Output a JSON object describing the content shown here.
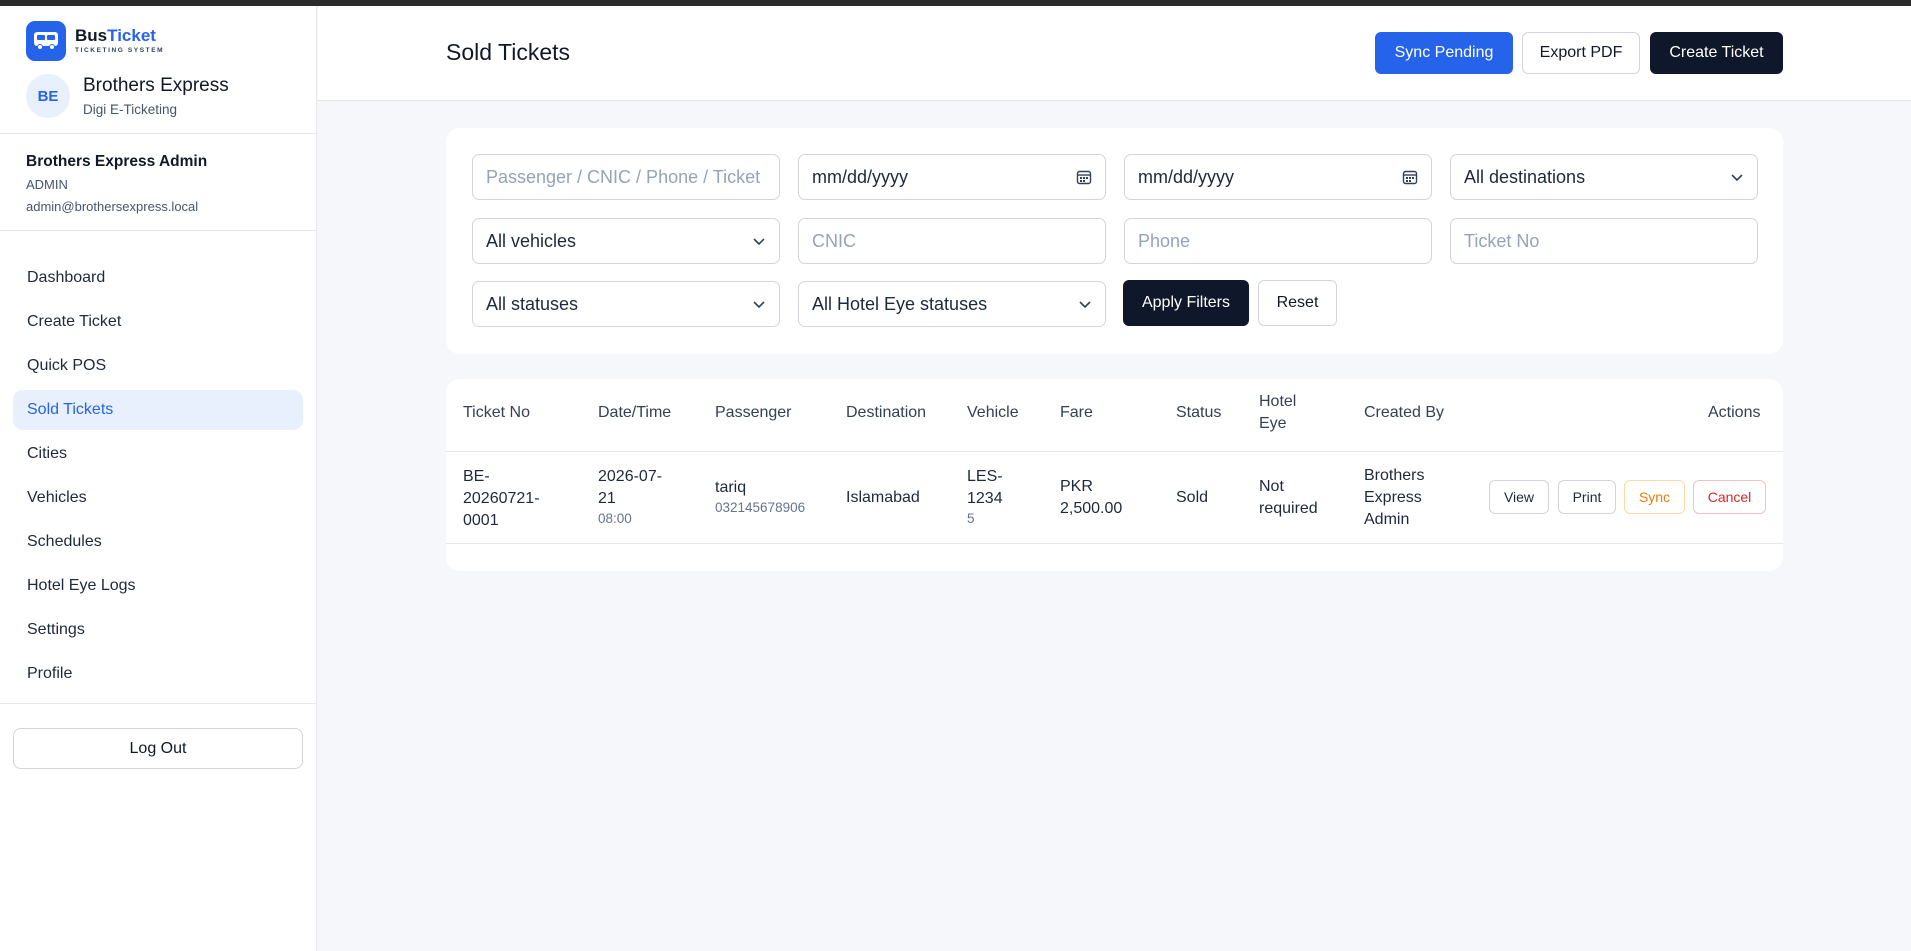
{
  "brand": {
    "name_part1": "Bus",
    "name_part2": "Ticket",
    "tagline": "TICKETING SYSTEM"
  },
  "company": {
    "initials": "BE",
    "name": "Brothers Express",
    "subtitle": "Digi E-Ticketing"
  },
  "user": {
    "name": "Brothers Express Admin",
    "role": "ADMIN",
    "email": "admin@brothersexpress.local"
  },
  "nav": [
    {
      "label": "Dashboard"
    },
    {
      "label": "Create Ticket"
    },
    {
      "label": "Quick POS"
    },
    {
      "label": "Sold Tickets",
      "active": true
    },
    {
      "label": "Cities"
    },
    {
      "label": "Vehicles"
    },
    {
      "label": "Schedules"
    },
    {
      "label": "Hotel Eye Logs"
    },
    {
      "label": "Settings"
    },
    {
      "label": "Profile"
    }
  ],
  "logout_label": "Log Out",
  "header": {
    "title": "Sold Tickets",
    "sync_pending": "Sync Pending",
    "export_pdf": "Export PDF",
    "create_ticket": "Create Ticket"
  },
  "filters": {
    "search_placeholder": "Passenger / CNIC / Phone / Ticket",
    "date_from": "mm/dd/yyyy",
    "date_to": "mm/dd/yyyy",
    "destination": "All destinations",
    "vehicle": "All vehicles",
    "cnic_placeholder": "CNIC",
    "phone_placeholder": "Phone",
    "ticket_placeholder": "Ticket No",
    "status": "All statuses",
    "hotel_eye_status": "All Hotel Eye statuses",
    "apply": "Apply Filters",
    "reset": "Reset"
  },
  "table": {
    "headers": {
      "ticket_no": "Ticket No",
      "datetime": "Date/Time",
      "passenger": "Passenger",
      "destination": "Destination",
      "vehicle": "Vehicle",
      "fare": "Fare",
      "status": "Status",
      "hotel_eye_1": "Hotel",
      "hotel_eye_2": "Eye",
      "created_by": "Created By",
      "actions": "Actions"
    },
    "rows": [
      {
        "ticket_l1": "BE-",
        "ticket_l2": "20260721-",
        "ticket_l3": "0001",
        "date_l1": "2026-07-",
        "date_l2": "21",
        "time": "08:00",
        "passenger": "tariq",
        "phone": "032145678906",
        "destination": "Islamabad",
        "vehicle_l1": "LES-",
        "vehicle_l2": "1234",
        "vehicle_sub": "5",
        "fare_l1": "PKR",
        "fare_l2": "2,500.00",
        "status": "Sold",
        "hotel_eye_l1": "Not",
        "hotel_eye_l2": "required",
        "created_l1": "Brothers",
        "created_l2": "Express",
        "created_l3": "Admin",
        "actions": {
          "view": "View",
          "print": "Print",
          "sync": "Sync",
          "cancel": "Cancel"
        }
      }
    ]
  },
  "colors": {
    "primary": "#2563eb",
    "dark": "#0f172a",
    "sync": "#ea7a0c",
    "cancel": "#dc2626"
  }
}
